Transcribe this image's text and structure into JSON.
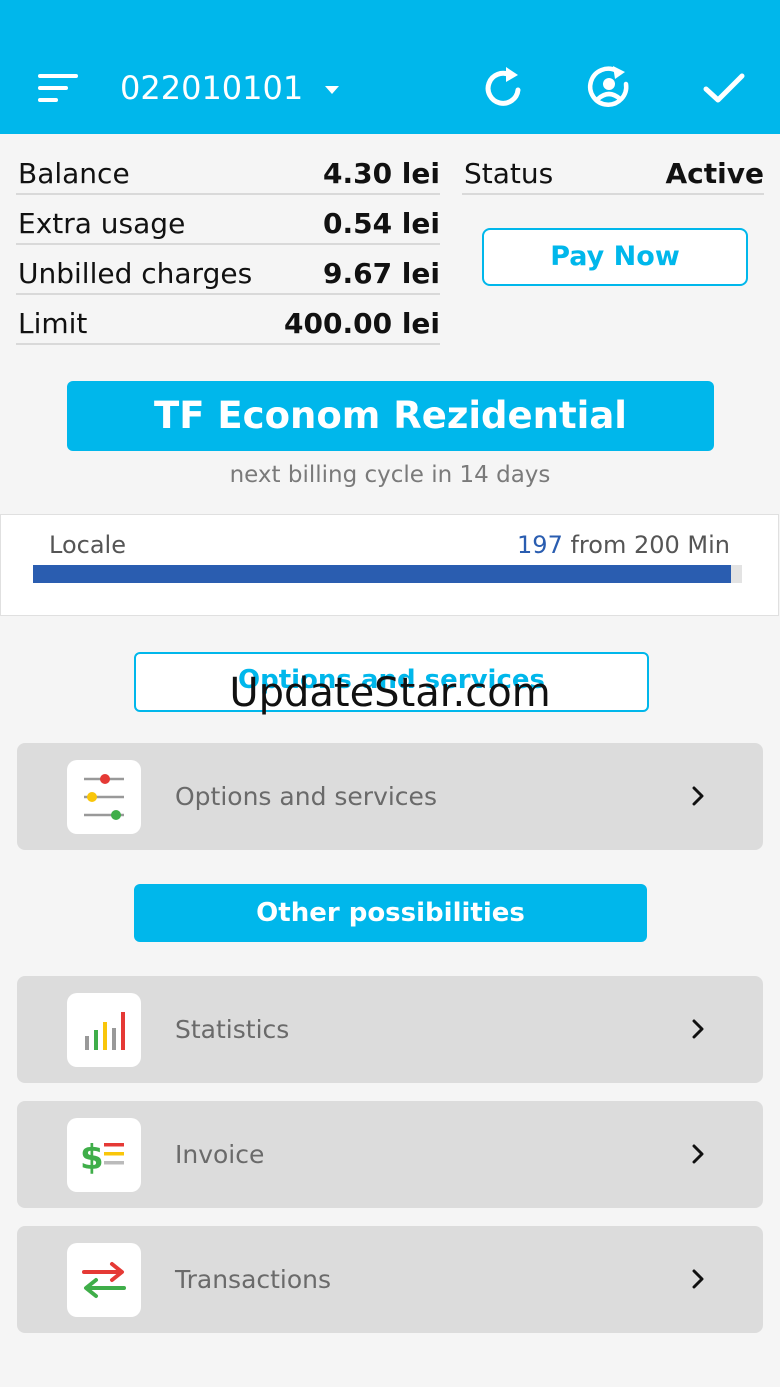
{
  "header": {
    "account_number": "022010101"
  },
  "account": {
    "rows": [
      {
        "label": "Balance",
        "value": "4.30 lei"
      },
      {
        "label": "Extra usage",
        "value": "0.54 lei"
      },
      {
        "label": "Unbilled charges",
        "value": "9.67 lei"
      },
      {
        "label": "Limit",
        "value": "400.00 lei"
      }
    ],
    "status_label": "Status",
    "status_value": "Active",
    "pay_button": "Pay Now"
  },
  "plan": {
    "name": "TF Econom Rezidential",
    "billing_note": "next billing cycle in 14 days"
  },
  "usage": {
    "name": "Locale",
    "used": "197",
    "from_text": "from 200 Min",
    "used_fraction": 0.985
  },
  "sections": {
    "options_header": "Options and services",
    "other_header": "Other possibilities"
  },
  "watermark": "UpdateStar.com",
  "menu": {
    "options": "Options and services",
    "statistics": "Statistics",
    "invoice": "Invoice",
    "transactions": "Transactions"
  },
  "colors": {
    "accent": "#00b7eb",
    "usage_bar": "#2a5db0",
    "item_bg": "#dcdcdc"
  }
}
